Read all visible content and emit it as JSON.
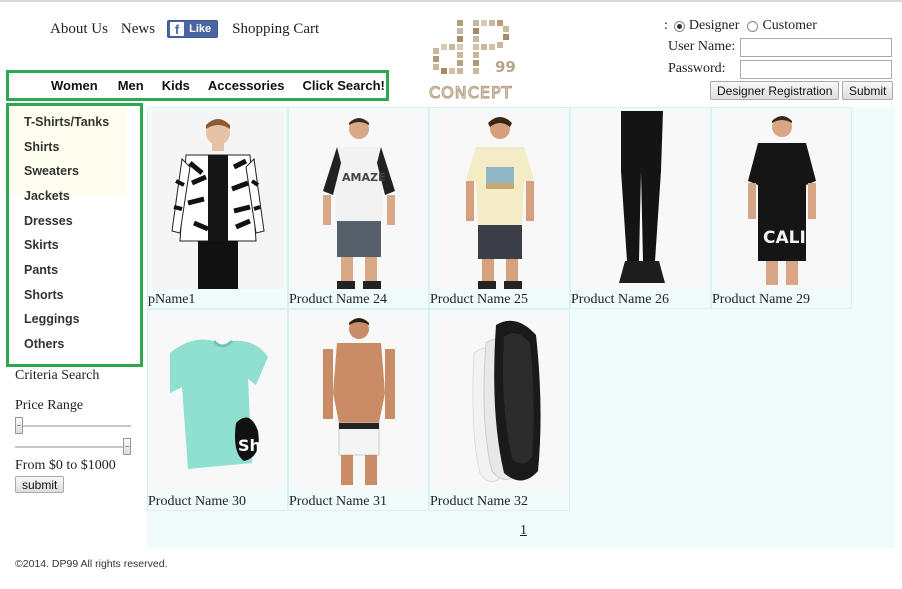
{
  "header": {
    "links": [
      "About Us",
      "News"
    ],
    "fb_like": "Like",
    "cart": "Shopping Cart"
  },
  "nav": [
    "Women",
    "Men",
    "Kids",
    "Accessories",
    "Click Search!"
  ],
  "login": {
    "role_prefix": ":",
    "roles": [
      "Designer",
      "Customer"
    ],
    "selected_role": "Designer",
    "username_label": "User Name:",
    "password_label": "Password:",
    "username_value": "",
    "password_value": "",
    "register_label": "Designer Registration",
    "submit_label": "Submit"
  },
  "categories": [
    "T-Shirts/Tanks",
    "Shirts",
    "Sweaters",
    "Jackets",
    "Dresses",
    "Skirts",
    "Pants",
    "Shorts",
    "Leggings",
    "Others"
  ],
  "filter": {
    "criteria_title": "Criteria Search",
    "price_title": "Price Range",
    "price_min_fraction": 0,
    "price_max_fraction": 1,
    "range_text": "From $0 to $1000",
    "submit_label": "submit"
  },
  "products": [
    {
      "name": "pName1",
      "item": "jacket"
    },
    {
      "name": "Product Name 24",
      "item": "raglan-tee"
    },
    {
      "name": "Product Name 25",
      "item": "graphic-tee"
    },
    {
      "name": "Product Name 26",
      "item": "leggings"
    },
    {
      "name": "Product Name 29",
      "item": "long-tee"
    },
    {
      "name": "Product Name 30",
      "item": "mint-tee"
    },
    {
      "name": "Product Name 31",
      "item": "boxer-briefs"
    },
    {
      "name": "Product Name 32",
      "item": "no-show-socks"
    }
  ],
  "pagination": {
    "current": "1"
  },
  "footer": {
    "copyright": "©2014. DP99 All rights reserved."
  },
  "colors": {
    "highlight_border": "#2fa84f",
    "grid_background": "#f0fcfc",
    "facebook": "#4a66a0"
  }
}
